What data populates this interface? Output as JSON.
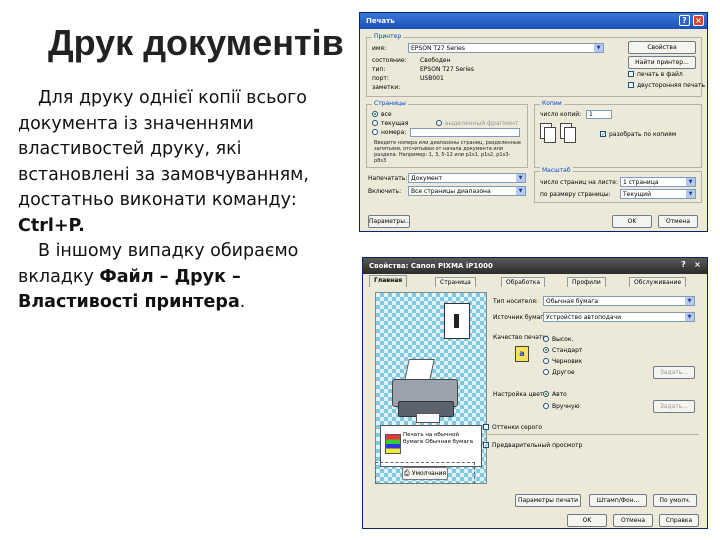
{
  "slide": {
    "title": "Друк документів",
    "para1": "Для друку однієї копії всього документа із значеннями властивостей друку, які встановлені за замовчуванням, достатньо виконати команду: ",
    "para1_bold": "Ctrl+P.",
    "para2_a": "В іншому випадку обираємо вкладку ",
    "para2_b": "Файл – Друк – Властивості принтера",
    "para2_end": "."
  },
  "print_dialog": {
    "title": "Печать",
    "printer_group": "Принтер",
    "name_label": "имя:",
    "printer_name": "EPSON T27 Series",
    "status_label": "состояние:",
    "status_value": "Свободен",
    "type_label": "тип:",
    "type_value": "EPSON T27 Series",
    "port_label": "порт:",
    "port_value": "USB001",
    "note_label": "заметки:",
    "properties_button": "Свойства",
    "find_printer_button": "Найти принтер...",
    "print_to_file": "печать в файл",
    "manual_duplex": "двусторонняя печать",
    "pages_group": "Страницы",
    "all_option": "все",
    "current_option": "текущая",
    "selection_option": "выделенный фрагмент",
    "pages_option": "номера:",
    "pages_hint": "Введите номера или диапазоны страниц, разделенные запятыми, отсчитывая от начала документа или раздела. Например: 1, 3, 5-12 или p1s1, p1s2, p1s3-p8s3",
    "copies_group": "Копии",
    "copies_label": "число копий:",
    "copies_value": "1",
    "collate_label": "разобрать по копиям",
    "print_what_label": "Напечатать:",
    "print_what_value": "Документ",
    "include_label": "Включить:",
    "include_value": "Все страницы диапазона",
    "scale_group": "Масштаб",
    "pages_per_sheet_label": "число страниц на листе:",
    "pages_per_sheet_value": "1 страница",
    "fit_label": "по размеру страницы:",
    "fit_value": "Текущий",
    "params_button": "Параметры...",
    "ok_button": "OK",
    "cancel_button": "Отмена"
  },
  "props_dialog": {
    "title": "Свойства: Canon PIXMA iP1000",
    "tabs": [
      "Главная",
      "Страница",
      "Обработка",
      "Профили",
      "Обслуживание"
    ],
    "media_type_label": "Тип носителя:",
    "media_type_value": "Обычная бумага",
    "paper_source_label": "Источник бумаги:",
    "paper_source_value": "Устройство автоподачи",
    "quality_label": "Качество печати:",
    "quality_options": [
      "Высок.",
      "Стандарт",
      "Черновик",
      "Другое"
    ],
    "quality_set_button": "Задать...",
    "color_label": "Настройка цвета:",
    "color_options": [
      "Авто",
      "Вручную"
    ],
    "color_set_button": "Задать...",
    "grayscale_label": "Оттенки серого",
    "preview_label": "Предварительный просмотр",
    "preview_caption": "Печать на обычной бумаге Обычная бумага",
    "defaults_button": "Умолчания",
    "print_options_button": "Параметры печати",
    "stamp_button": "Штамп/Фон...",
    "defaults2_button": "По умолч.",
    "ok_button": "OK",
    "cancel_button": "Отмена",
    "apply_button": "Справка"
  }
}
